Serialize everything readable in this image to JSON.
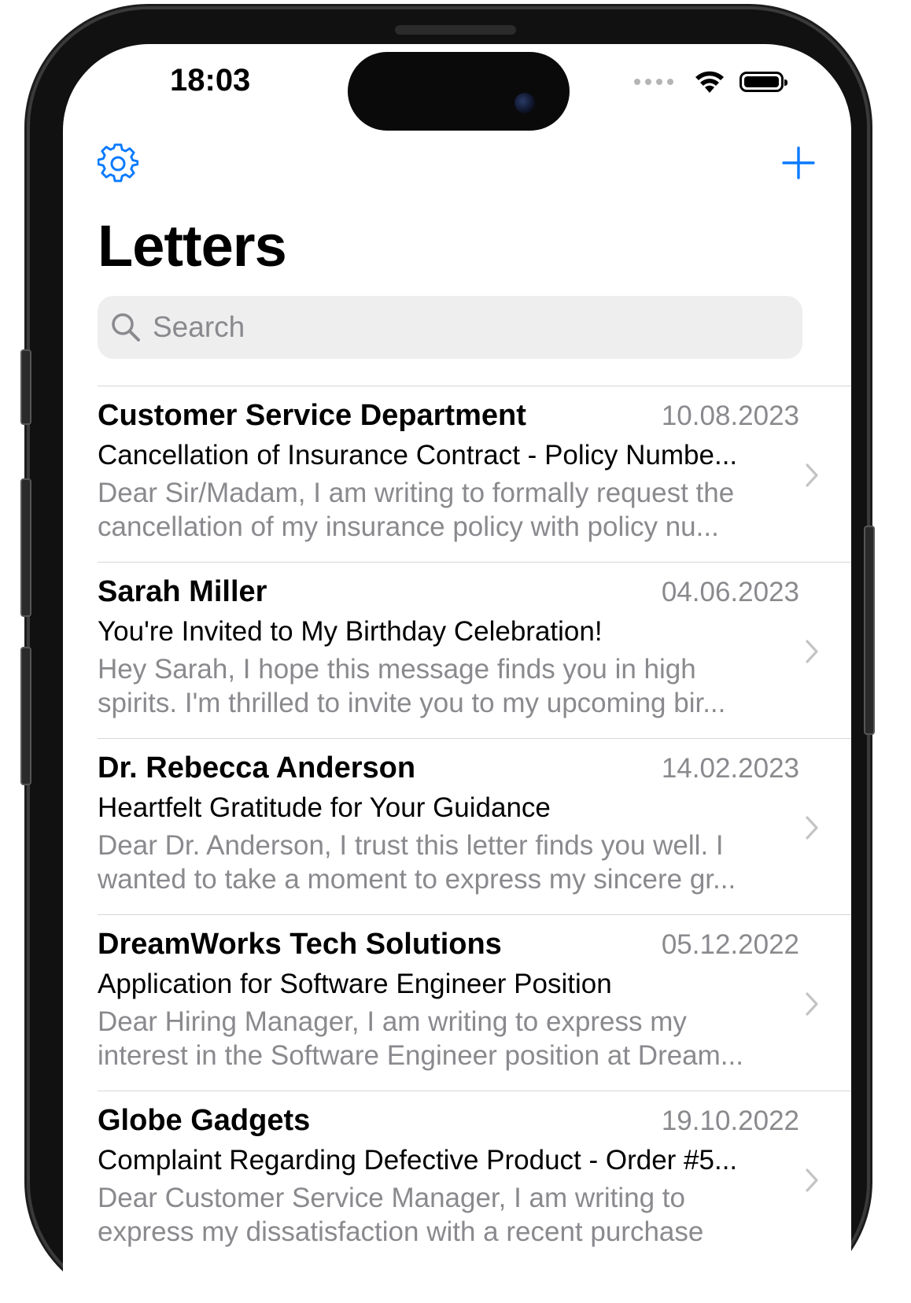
{
  "status_bar": {
    "time": "18:03"
  },
  "nav": {
    "title": "Letters"
  },
  "search": {
    "placeholder": "Search"
  },
  "letters": [
    {
      "sender": "Customer Service Department",
      "date": "10.08.2023",
      "subject": "Cancellation of Insurance Contract - Policy Numbe...",
      "preview": "Dear Sir/Madam,  I am writing to formally request the cancellation of my insurance policy with policy nu..."
    },
    {
      "sender": "Sarah Miller",
      "date": "04.06.2023",
      "subject": "You're Invited to My Birthday Celebration!",
      "preview": "Hey Sarah,  I hope this message finds you in high spirits. I'm thrilled to invite you to my upcoming bir..."
    },
    {
      "sender": "Dr. Rebecca Anderson",
      "date": "14.02.2023",
      "subject": "Heartfelt Gratitude for Your Guidance",
      "preview": "Dear Dr. Anderson,  I trust this letter finds you well. I wanted to take a moment to express my sincere gr..."
    },
    {
      "sender": "DreamWorks Tech Solutions",
      "date": "05.12.2022",
      "subject": "Application for Software Engineer Position",
      "preview": "Dear Hiring Manager,  I am writing to express my interest in the Software Engineer position at Dream..."
    },
    {
      "sender": "Globe Gadgets",
      "date": "19.10.2022",
      "subject": "Complaint Regarding Defective Product - Order #5...",
      "preview": "Dear Customer Service Manager,  I am writing to express my dissatisfaction with a recent purchase"
    }
  ],
  "colors": {
    "accent": "#0a7aff",
    "secondary_text": "#8a8a8e",
    "separator": "#d6d6d8",
    "search_bg": "#eeeeef"
  },
  "icons": {
    "settings": "gear-icon",
    "compose": "plus-icon",
    "search": "magnifying-glass-icon",
    "row_disclosure": "chevron-right-icon",
    "wifi": "wifi-icon",
    "battery": "battery-icon",
    "cellular": "cellular-dots-icon"
  }
}
